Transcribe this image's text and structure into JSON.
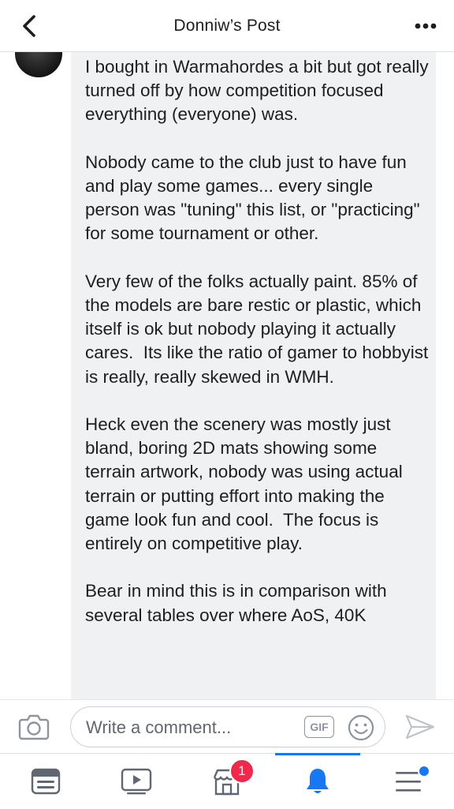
{
  "header": {
    "title": "Donniw’s Post",
    "back_icon": "chevron-left-icon",
    "more_icon": "ellipsis-icon"
  },
  "comment": {
    "paragraphs": [
      "I bought in Warmahordes a bit but got really turned off by how competition focused everything (everyone) was.",
      "Nobody came to the club just to have fun and play some games... every single person was \"tuning\" this list, or \"practicing\" for some tournament or other.",
      "Very few of the folks actually paint. 85% of the models are bare restic or plastic, which itself is ok but nobody playing it actually cares.  Its like the ratio of gamer to hobbyist is really, really skewed in WMH.",
      "Heck even the scenery was mostly just bland, boring 2D mats showing some terrain artwork, nobody was using actual terrain or putting effort into making the game look fun and cool.  The focus is entirely on competitive play.",
      "Bear in mind this is in comparison with several tables over where AoS, 40K"
    ]
  },
  "composer": {
    "placeholder": "Write a comment...",
    "gif_label": "GIF"
  },
  "tabs": [
    {
      "icon": "news-feed-icon"
    },
    {
      "icon": "video-icon"
    },
    {
      "icon": "marketplace-icon",
      "badge": "1"
    },
    {
      "icon": "notifications-bell-icon",
      "active": true
    },
    {
      "icon": "menu-icon",
      "dot": true
    }
  ],
  "colors": {
    "accent": "#1877f2",
    "badge": "#f02849",
    "bubble": "#f0f1f3"
  }
}
